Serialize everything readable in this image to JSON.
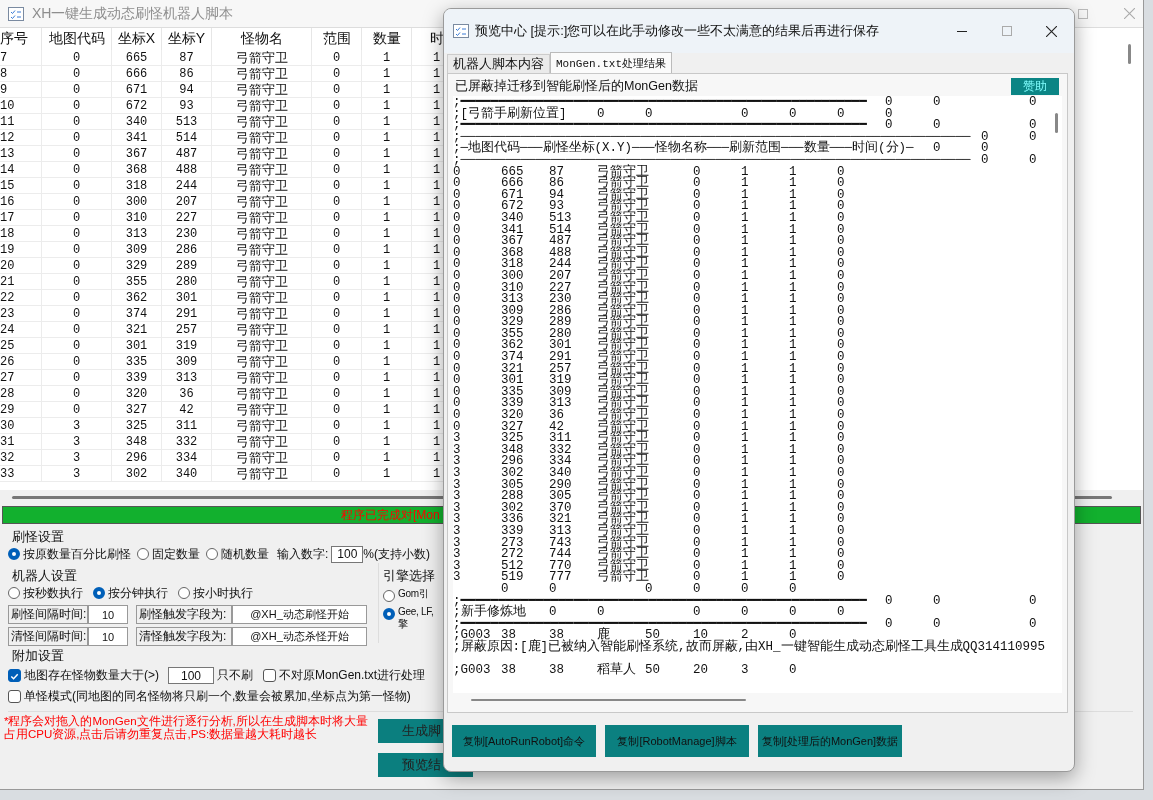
{
  "main_window": {
    "title": "XH一键生成动态刷怪机器人脚本",
    "table": {
      "columns": [
        "序号",
        "地图代码",
        "坐标X",
        "坐标Y",
        "怪物名",
        "范围",
        "数量",
        "时"
      ],
      "rows": [
        [
          "7",
          "0",
          "665",
          "87",
          "弓箭守卫",
          "0",
          "1",
          "1"
        ],
        [
          "8",
          "0",
          "666",
          "86",
          "弓箭守卫",
          "0",
          "1",
          "1"
        ],
        [
          "9",
          "0",
          "671",
          "94",
          "弓箭守卫",
          "0",
          "1",
          "1"
        ],
        [
          "10",
          "0",
          "672",
          "93",
          "弓箭守卫",
          "0",
          "1",
          "1"
        ],
        [
          "11",
          "0",
          "340",
          "513",
          "弓箭守卫",
          "0",
          "1",
          "1"
        ],
        [
          "12",
          "0",
          "341",
          "514",
          "弓箭守卫",
          "0",
          "1",
          "1"
        ],
        [
          "13",
          "0",
          "367",
          "487",
          "弓箭守卫",
          "0",
          "1",
          "1"
        ],
        [
          "14",
          "0",
          "368",
          "488",
          "弓箭守卫",
          "0",
          "1",
          "1"
        ],
        [
          "15",
          "0",
          "318",
          "244",
          "弓箭守卫",
          "0",
          "1",
          "1"
        ],
        [
          "16",
          "0",
          "300",
          "207",
          "弓箭守卫",
          "0",
          "1",
          "1"
        ],
        [
          "17",
          "0",
          "310",
          "227",
          "弓箭守卫",
          "0",
          "1",
          "1"
        ],
        [
          "18",
          "0",
          "313",
          "230",
          "弓箭守卫",
          "0",
          "1",
          "1"
        ],
        [
          "19",
          "0",
          "309",
          "286",
          "弓箭守卫",
          "0",
          "1",
          "1"
        ],
        [
          "20",
          "0",
          "329",
          "289",
          "弓箭守卫",
          "0",
          "1",
          "1"
        ],
        [
          "21",
          "0",
          "355",
          "280",
          "弓箭守卫",
          "0",
          "1",
          "1"
        ],
        [
          "22",
          "0",
          "362",
          "301",
          "弓箭守卫",
          "0",
          "1",
          "1"
        ],
        [
          "23",
          "0",
          "374",
          "291",
          "弓箭守卫",
          "0",
          "1",
          "1"
        ],
        [
          "24",
          "0",
          "321",
          "257",
          "弓箭守卫",
          "0",
          "1",
          "1"
        ],
        [
          "25",
          "0",
          "301",
          "319",
          "弓箭守卫",
          "0",
          "1",
          "1"
        ],
        [
          "26",
          "0",
          "335",
          "309",
          "弓箭守卫",
          "0",
          "1",
          "1"
        ],
        [
          "27",
          "0",
          "339",
          "313",
          "弓箭守卫",
          "0",
          "1",
          "1"
        ],
        [
          "28",
          "0",
          "320",
          "36",
          "弓箭守卫",
          "0",
          "1",
          "1"
        ],
        [
          "29",
          "0",
          "327",
          "42",
          "弓箭守卫",
          "0",
          "1",
          "1"
        ],
        [
          "30",
          "3",
          "325",
          "311",
          "弓箭守卫",
          "0",
          "1",
          "1"
        ],
        [
          "31",
          "3",
          "348",
          "332",
          "弓箭守卫",
          "0",
          "1",
          "1"
        ],
        [
          "32",
          "3",
          "296",
          "334",
          "弓箭守卫",
          "0",
          "1",
          "1"
        ],
        [
          "33",
          "3",
          "302",
          "340",
          "弓箭守卫",
          "0",
          "1",
          "1"
        ]
      ]
    },
    "status_text": "程序已完成对[Mon",
    "spawn_settings": {
      "title": "刷怪设置",
      "options": [
        {
          "label": "按原数量百分比刷怪",
          "selected": true
        },
        {
          "label": "固定数量",
          "selected": false
        },
        {
          "label": "随机数量",
          "selected": false
        }
      ],
      "input_label": "输入数字:",
      "input_value": "100",
      "input_suffix": "%(支持小数)"
    },
    "robot_settings": {
      "title": "机器人设置",
      "options": [
        {
          "label": "按秒数执行",
          "selected": false
        },
        {
          "label": "按分钟执行",
          "selected": true
        },
        {
          "label": "按小时执行",
          "selected": false
        }
      ],
      "fields": [
        {
          "label": "刷怪间隔时间:",
          "value": "10",
          "trigger_label": "刷怪触发字段为:",
          "trigger_value": "@XH_动态刷怪开始"
        },
        {
          "label": "清怪间隔时间:",
          "value": "10",
          "trigger_label": "清怪触发字段为:",
          "trigger_value": "@XH_动态杀怪开始"
        }
      ]
    },
    "engine": {
      "title": "引擎选择",
      "options": [
        {
          "label": "Gom引",
          "selected": false
        },
        {
          "label": "Gee, LF,\n擎",
          "selected": true
        }
      ]
    },
    "extra": {
      "title": "附加设置",
      "rows": [
        [
          {
            "kind": "limit",
            "label": "地图存在怪物数量大于(>)",
            "checked": true,
            "value": "100",
            "suffix": "只不刷"
          },
          {
            "kind": "check",
            "label": "不对原MonGen.txt进行处理",
            "checked": false
          }
        ],
        [
          {
            "kind": "check",
            "label": "单怪模式(同地图的同名怪物将只刷一个,数量会被累加,坐标点为第一怪物)",
            "checked": false
          }
        ]
      ]
    },
    "note": "*程序会对拖入的MonGen文件进行逐行分析,所以在生成脚本时将大量占用CPU资源,点击后请勿重复点击,PS:数据量越大耗时越长",
    "buttons": [
      "生成脚",
      "预览结"
    ]
  },
  "dialog": {
    "title": "预览中心 [提示:]您可以在此手动修改一些不太满意的结果后再进行保存",
    "tabs": [
      {
        "label": "机器人脚本内容",
        "selected": false
      },
      {
        "label": "MonGen.txt处理结果",
        "selected": true
      }
    ],
    "group_label": "已屏蔽掉迁移到智能刷怪后的MonGen数据",
    "sponsor_button": "赞助",
    "lines": [
      {
        "text": ";━━━━━━━━━━━━━━━━━━━━━━━━━━━━━━━━━━━━━━━━━━━━━━━━━━━━━━\t0\t0\t\t0"
      },
      {
        "text": ";[弓箭手刷新位置]\t0\t0\t\t0\t0\t0\t0"
      },
      {
        "text": ";━━━━━━━━━━━━━━━━━━━━━━━━━━━━━━━━━━━━━━━━━━━━━━━━━━━━━━\t0\t0\t\t0"
      },
      {
        "text": ";────────────────────────────────────────────────────────────────────\t0\t0"
      },
      {
        "text": ";─地图代码───刷怪坐标(X.Y)───怪物名称───刷新范围───数量───时间(分)─\t0\t0"
      },
      {
        "text": ";────────────────────────────────────────────────────────────────────\t0\t0"
      },
      {
        "text": "0\t665\t87\t弓箭守卫\t0\t1\t1\t0"
      },
      {
        "text": "0\t666\t86\t弓箭守卫\t0\t1\t1\t0"
      },
      {
        "text": "0\t671\t94\t弓箭守卫\t0\t1\t1\t0"
      },
      {
        "text": "0\t672\t93\t弓箭守卫\t0\t1\t1\t0"
      },
      {
        "text": "0\t340\t513\t弓箭守卫\t0\t1\t1\t0"
      },
      {
        "text": "0\t341\t514\t弓箭守卫\t0\t1\t1\t0"
      },
      {
        "text": "0\t367\t487\t弓箭守卫\t0\t1\t1\t0"
      },
      {
        "text": "0\t368\t488\t弓箭守卫\t0\t1\t1\t0"
      },
      {
        "text": "0\t318\t244\t弓箭守卫\t0\t1\t1\t0"
      },
      {
        "text": "0\t300\t207\t弓箭守卫\t0\t1\t1\t0"
      },
      {
        "text": "0\t310\t227\t弓箭守卫\t0\t1\t1\t0"
      },
      {
        "text": "0\t313\t230\t弓箭守卫\t0\t1\t1\t0"
      },
      {
        "text": "0\t309\t286\t弓箭守卫\t0\t1\t1\t0"
      },
      {
        "text": "0\t329\t289\t弓箭守卫\t0\t1\t1\t0"
      },
      {
        "text": "0\t355\t280\t弓箭守卫\t0\t1\t1\t0"
      },
      {
        "text": "0\t362\t301\t弓箭守卫\t0\t1\t1\t0"
      },
      {
        "text": "0\t374\t291\t弓箭守卫\t0\t1\t1\t0"
      },
      {
        "text": "0\t321\t257\t弓箭守卫\t0\t1\t1\t0"
      },
      {
        "text": "0\t301\t319\t弓箭守卫\t0\t1\t1\t0"
      },
      {
        "text": "0\t335\t309\t弓箭守卫\t0\t1\t1\t0"
      },
      {
        "text": "0\t339\t313\t弓箭守卫\t0\t1\t1\t0"
      },
      {
        "text": "0\t320\t36\t弓箭守卫\t0\t1\t1\t0"
      },
      {
        "text": "0\t327\t42\t弓箭守卫\t0\t1\t1\t0"
      },
      {
        "text": "3\t325\t311\t弓箭守卫\t0\t1\t1\t0"
      },
      {
        "text": "3\t348\t332\t弓箭守卫\t0\t1\t1\t0"
      },
      {
        "text": "3\t296\t334\t弓箭守卫\t0\t1\t1\t0"
      },
      {
        "text": "3\t302\t340\t弓箭守卫\t0\t1\t1\t0"
      },
      {
        "text": "3\t305\t290\t弓箭守卫\t0\t1\t1\t0"
      },
      {
        "text": "3\t288\t305\t弓箭守卫\t0\t1\t1\t0"
      },
      {
        "text": "3\t302\t370\t弓箭守卫\t0\t1\t1\t0"
      },
      {
        "text": "3\t336\t321\t弓箭守卫\t0\t1\t1\t0"
      },
      {
        "text": "3\t339\t313\t弓箭守卫\t0\t1\t1\t0"
      },
      {
        "text": "3\t273\t743\t弓箭守卫\t0\t1\t1\t0"
      },
      {
        "text": "3\t272\t744\t弓箭守卫\t0\t1\t1\t0"
      },
      {
        "text": "3\t512\t770\t弓箭守卫\t0\t1\t1\t0"
      },
      {
        "text": "3\t519\t777\t弓箭守卫\t0\t1\t1\t0"
      },
      {
        "text": "\t0\t0\t\t0\t0\t0\t0"
      },
      {
        "text": ";━━━━━━━━━━━━━━━━━━━━━━━━━━━━━━━━━━━━━━━━━━━━━━━━━━━━━━\t0\t0\t\t0"
      },
      {
        "text": ";新手修炼地\t0\t0\t\t0\t0\t0\t0"
      },
      {
        "text": ";━━━━━━━━━━━━━━━━━━━━━━━━━━━━━━━━━━━━━━━━━━━━━━━━━━━━━━\t0\t0\t\t0"
      },
      {
        "text": ";G003\t38\t38\t鹿\t50\t10\t2\t0"
      },
      {
        "text": ";屏蔽原因:[鹿]已被纳入智能刷怪系统,故而屏蔽,由XH_一键智能生成动态刷怪工具生成QQ314110995"
      },
      {
        "text": ";G003\t38\t38\t稻草人\t50\t20\t3\t0",
        "blank_before": true
      }
    ],
    "buttons": [
      "复制[AutoRunRobot]命令",
      "复制[RobotManage]脚本",
      "复制[处理后的MonGen]数据"
    ]
  }
}
